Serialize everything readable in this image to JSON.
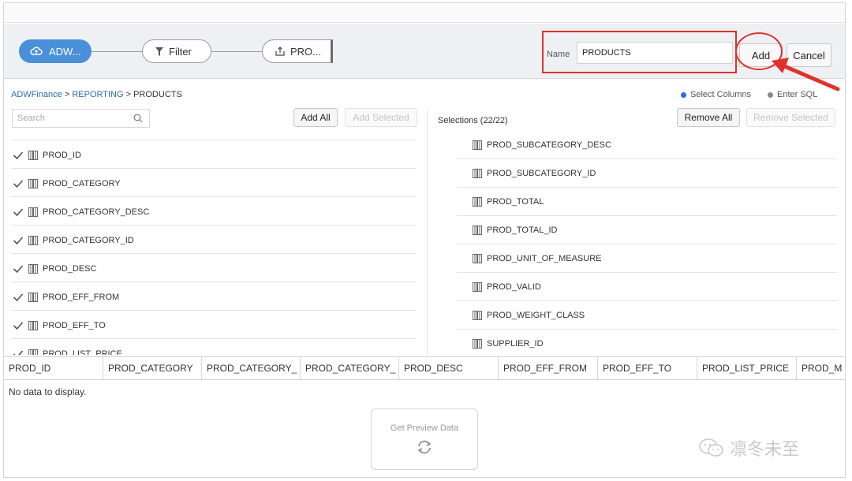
{
  "pipeline": {
    "source_label": "ADW...",
    "filter_label": "Filter",
    "target_label": "PRO..."
  },
  "name_field": {
    "label": "Name",
    "value": "PRODUCTS"
  },
  "buttons": {
    "add": "Add",
    "cancel": "Cancel",
    "add_all": "Add All",
    "add_selected": "Add Selected",
    "remove_all": "Remove All",
    "remove_selected": "Remove Selected",
    "get_preview": "Get Preview Data"
  },
  "breadcrumb": {
    "part1": "ADWFinance",
    "sep1": " > ",
    "part2": "REPORTING",
    "sep2": " > ",
    "part3": "PRODUCTS"
  },
  "mode": {
    "select_columns": "Select Columns",
    "enter_sql": "Enter SQL",
    "select_color": "#2b6cd8",
    "sql_color": "#8a8a8a"
  },
  "search": {
    "placeholder": "Search"
  },
  "selections_label": "Selections (22/22)",
  "left_columns": [
    "PROD_ID",
    "PROD_CATEGORY",
    "PROD_CATEGORY_DESC",
    "PROD_CATEGORY_ID",
    "PROD_DESC",
    "PROD_EFF_FROM",
    "PROD_EFF_TO",
    "PROD_LIST_PRICE"
  ],
  "right_columns": [
    "PROD_SUBCATEGORY_DESC",
    "PROD_SUBCATEGORY_ID",
    "PROD_TOTAL",
    "PROD_TOTAL_ID",
    "PROD_UNIT_OF_MEASURE",
    "PROD_VALID",
    "PROD_WEIGHT_CLASS",
    "SUPPLIER_ID"
  ],
  "grid_headers": [
    "PROD_ID",
    "PROD_CATEGORY",
    "PROD_CATEGORY_",
    "PROD_CATEGORY_",
    "PROD_DESC",
    "PROD_EFF_FROM",
    "PROD_EFF_TO",
    "PROD_LIST_PRICE",
    "PROD_M"
  ],
  "no_data": "No data to display.",
  "watermark": "凛冬未至",
  "colors": {
    "accent": "#4a90d9",
    "annotation_red": "#e0322c"
  }
}
